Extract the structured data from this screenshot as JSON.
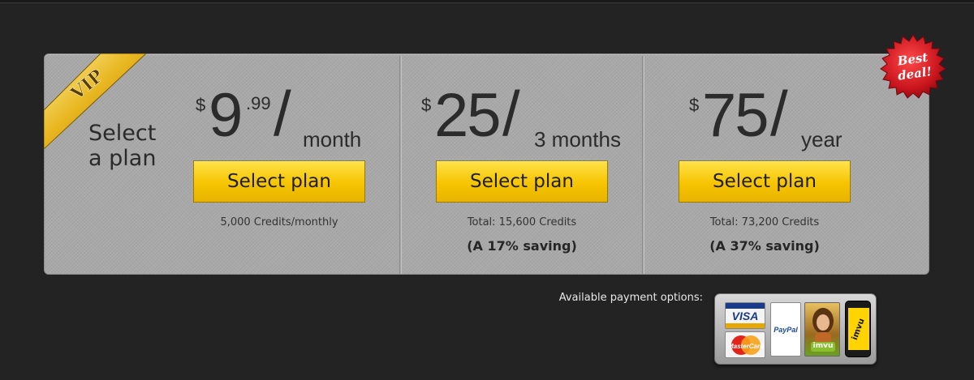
{
  "ribbon": {
    "label": "VIP"
  },
  "intro": {
    "line1": "Select",
    "line2": "a plan"
  },
  "badge": {
    "line1": "Best",
    "line2": "deal!"
  },
  "plans": [
    {
      "currency": "$",
      "amount": "9",
      "cents": ".99",
      "slash": "/",
      "period": "month",
      "button_label": "Select plan",
      "detail": "5,000 Credits/monthly",
      "saving": ""
    },
    {
      "currency": "$",
      "amount": "25",
      "cents": "",
      "slash": "/",
      "period": "3 months",
      "button_label": "Select plan",
      "detail": "Total: 15,600 Credits",
      "saving": "(A 17% saving)"
    },
    {
      "currency": "$",
      "amount": "75",
      "cents": "",
      "slash": "/",
      "period": "year",
      "button_label": "Select plan",
      "detail": "Total: 73,200 Credits",
      "saving": "(A 37% saving)"
    }
  ],
  "payment": {
    "label": "Available payment options:",
    "methods": [
      {
        "name": "VISA",
        "icon": "visa-card-icon"
      },
      {
        "name": "MasterCard",
        "icon": "mastercard-icon"
      },
      {
        "name": "PayPal",
        "icon": "paypal-icon"
      },
      {
        "name": "imvu",
        "icon": "imvu-card-icon"
      },
      {
        "name": "imvu",
        "icon": "imvu-mobile-icon"
      }
    ]
  },
  "colors": {
    "page_bg": "#232323",
    "panel_bg": "#a9a9a9",
    "button_yellow": "#f6c400",
    "ribbon_gold": "#e0b020",
    "badge_red": "#c8141c"
  }
}
